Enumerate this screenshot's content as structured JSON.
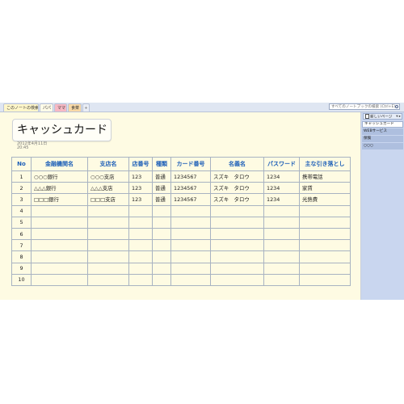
{
  "tabs": [
    {
      "label": "このノートの検索"
    },
    {
      "label": "パパ"
    },
    {
      "label": "ママ"
    },
    {
      "label": "食菜"
    }
  ],
  "search": {
    "placeholder": "すべてのノートブックの検索 (Ctrl+E)"
  },
  "page": {
    "title": "キャッシュカード",
    "date": "2012年4月11日",
    "time": "20:45"
  },
  "table": {
    "headers": [
      "No",
      "金融機関名",
      "支店名",
      "店番号",
      "種類",
      "カード番号",
      "名義名",
      "パスワード",
      "主な引き落とし"
    ],
    "rows": [
      [
        "1",
        "○○○銀行",
        "○○○支店",
        "123",
        "普通",
        "1234567",
        "スズキ　タロウ",
        "1234",
        "携帯電話"
      ],
      [
        "2",
        "△△△銀行",
        "△△△支店",
        "123",
        "普通",
        "1234567",
        "スズキ　タロウ",
        "1234",
        "家賃"
      ],
      [
        "3",
        "□□□銀行",
        "□□□支店",
        "123",
        "普通",
        "1234567",
        "スズキ　タロウ",
        "1234",
        "光熱費"
      ],
      [
        "4",
        "",
        "",
        "",
        "",
        "",
        "",
        "",
        ""
      ],
      [
        "5",
        "",
        "",
        "",
        "",
        "",
        "",
        "",
        ""
      ],
      [
        "6",
        "",
        "",
        "",
        "",
        "",
        "",
        "",
        ""
      ],
      [
        "7",
        "",
        "",
        "",
        "",
        "",
        "",
        "",
        ""
      ],
      [
        "8",
        "",
        "",
        "",
        "",
        "",
        "",
        "",
        ""
      ],
      [
        "9",
        "",
        "",
        "",
        "",
        "",
        "",
        "",
        ""
      ],
      [
        "10",
        "",
        "",
        "",
        "",
        "",
        "",
        "",
        ""
      ]
    ]
  },
  "sidebar": {
    "new_page_label": "新しいページ",
    "pages": [
      {
        "label": "キャッシュカード"
      },
      {
        "label": "WEBサービス"
      },
      {
        "label": "保険"
      },
      {
        "label": "○○○"
      }
    ]
  },
  "colors": {
    "page_bg": "#fefbe3",
    "header_text": "#1d5fb8",
    "sidebar_bg": "#c9d6ef"
  }
}
